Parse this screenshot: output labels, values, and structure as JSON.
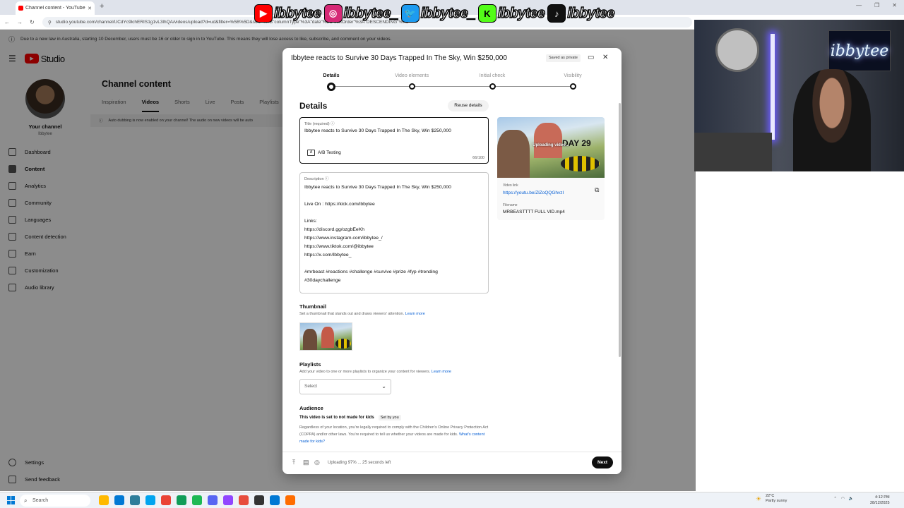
{
  "browser": {
    "tab_title": "Channel content - YouTube Studio",
    "tab_close": "✕",
    "new_tab": "+",
    "url": "studio.youtube.com/channel/UCdYc9lchERIS1g1vL3lhQA/videos/upload?d=ud&filter=%5B%5D&sort=%7B\"columnType\"%3A\"date\"%2C\"sortOrder\"%3A\"DESCENDING\"%7D",
    "win_minimize": "—",
    "win_maximize": "❐",
    "win_close": "✕"
  },
  "overlay": {
    "handles": [
      "ibbytee",
      "ibbytee_",
      "ibbytee_",
      "ibbytee",
      "ibbytee"
    ],
    "icons": [
      "youtube-icon",
      "instagram-icon",
      "twitter-icon",
      "kick-icon",
      "tiktok-icon"
    ],
    "colors": [
      "#ff0000",
      "#d62976",
      "#1d9bf0",
      "#53fc18",
      "#111111"
    ],
    "glyphs": [
      "▶",
      "◎",
      "🐦",
      "K",
      "♪"
    ]
  },
  "infobar": {
    "text": "Due to a new law in Australia, starting 10 December, users must be 16 or older to sign in to YouTube. This means they will lose access to like, subscribe, and comment on your videos."
  },
  "studio": {
    "logo_text": "Studio"
  },
  "sidebar": {
    "channel_title": "Your channel",
    "channel_name": "Ibbytee",
    "items": [
      {
        "label": "Dashboard",
        "icon": "dashboard-icon"
      },
      {
        "label": "Content",
        "icon": "content-icon"
      },
      {
        "label": "Analytics",
        "icon": "analytics-icon"
      },
      {
        "label": "Community",
        "icon": "community-icon"
      },
      {
        "label": "Languages",
        "icon": "languages-icon"
      },
      {
        "label": "Content detection",
        "icon": "content-detection-icon"
      },
      {
        "label": "Earn",
        "icon": "earn-icon"
      },
      {
        "label": "Customization",
        "icon": "customization-icon"
      },
      {
        "label": "Audio library",
        "icon": "audio-library-icon"
      }
    ],
    "settings": "Settings",
    "feedback": "Send feedback"
  },
  "main": {
    "title": "Channel content",
    "tabs": [
      "Inspiration",
      "Videos",
      "Shorts",
      "Live",
      "Posts",
      "Playlists"
    ],
    "auto_dub": "Auto dubbing is now enabled on your channel! The audio on new videos will be auto"
  },
  "modal": {
    "title": "Ibbytee reacts to Survive 30 Days Trapped In The Sky, Win $250,000",
    "saved": "Saved as private",
    "steps": [
      "Details",
      "Video elements",
      "Initial check",
      "Visibility"
    ],
    "details_heading": "Details",
    "reuse_button": "Reuse details",
    "title_label": "Title (required)",
    "title_value": "Ibbytee reacts to Survive 30 Days Trapped In The Sky, Win $250,000",
    "ab_testing": "A/B Testing",
    "title_count": "66/100",
    "desc_label": "Description",
    "desc_lines": [
      "Ibbytee reacts to Survive 30 Days Trapped In The Sky, Win $250,000",
      "",
      "Live On : https://kick.com/ibbytee",
      "",
      "Links:",
      "https://discord.gg/ozgbEeKh",
      "https://www.instagram.com/ibbytee_/",
      "https://www.tiktok.com/@ibbytee",
      "https://x.com/Ibbytee_",
      "",
      "#mrbeast #reactions #challenge #survive #prize #fyp #trending",
      "#30daychallenge"
    ],
    "video_overlay": "Uploading video...",
    "video_day_text": "DAY 29",
    "video_link_label": "Video link",
    "video_link": "https://youtu.be/ZlZoQQGhvzI",
    "filename_label": "Filename",
    "filename": "MRBEASTTTT FULL VID.mp4",
    "thumbnail_heading": "Thumbnail",
    "thumbnail_sub": "Set a thumbnail that stands out and draws viewers' attention.",
    "learn_more": "Learn more",
    "playlists_heading": "Playlists",
    "playlists_sub": "Add your video to one or more playlists to organize your content for viewers.",
    "select_placeholder": "Select",
    "audience_heading": "Audience",
    "audience_status": "This video is set to not made for kids",
    "set_by_you": "Set by you",
    "audience_text": "Regardless of your location, you're legally required to comply with the Children's Online Privacy Protection Act (COPPA) and/or other laws. You're required to tell us whether your videos are made for kids.",
    "audience_link": "What's content made for kids?",
    "upload_status": "Uploading 97% ... 25 seconds left",
    "next_button": "Next"
  },
  "webcam": {
    "neon_text": "ibbytee"
  },
  "taskbar": {
    "search_placeholder": "Search",
    "app_colors": [
      "#ffb900",
      "#0078d4",
      "#2d7d9a",
      "#00a4ef",
      "#ea4335",
      "#0f9d58",
      "#1db954",
      "#5865f2",
      "#9146ff",
      "#e74c3c",
      "#333333",
      "#0078d4",
      "#ff6d00"
    ],
    "weather_temp": "22°C",
    "weather_desc": "Partly sunny",
    "time": "4:12 PM",
    "date": "28/12/2025"
  }
}
